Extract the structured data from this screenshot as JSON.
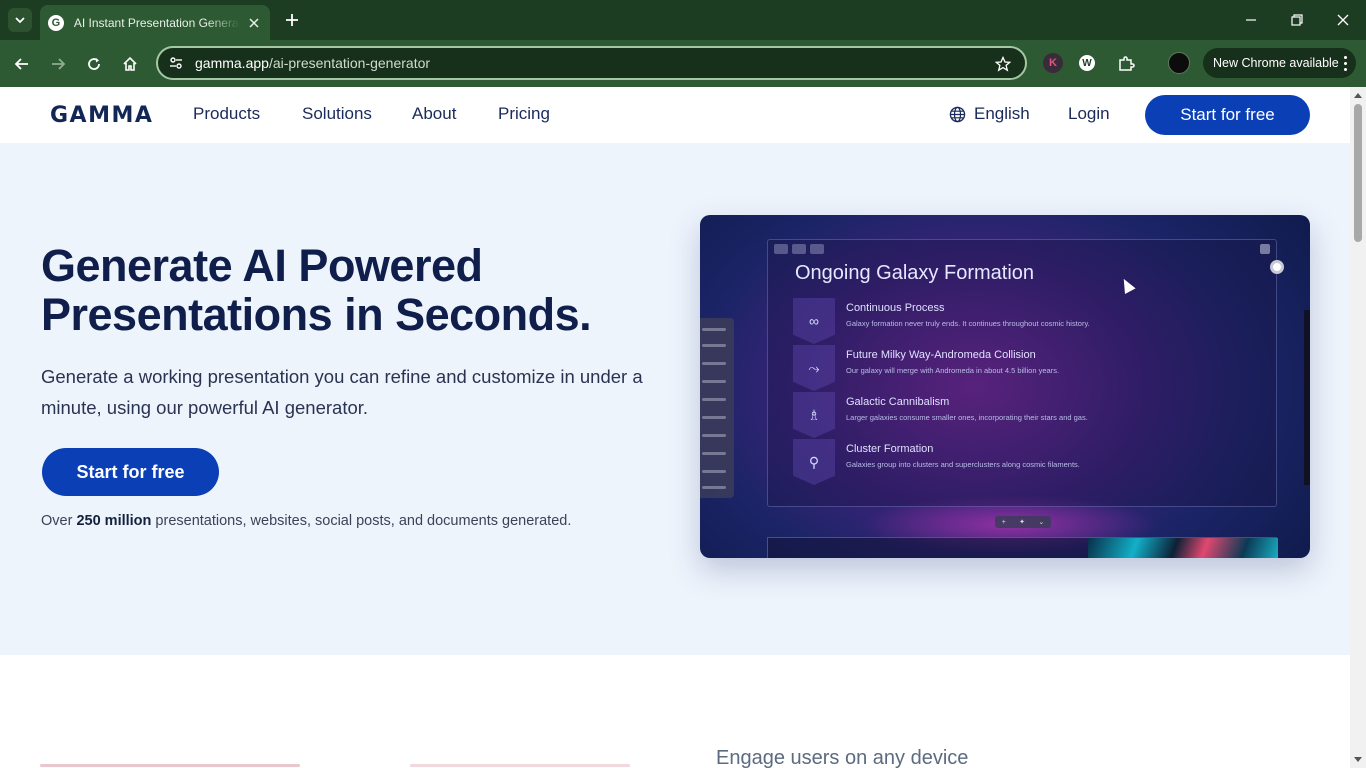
{
  "browser": {
    "tab_title": "AI Instant Presentation Generator",
    "tab_favicon_letter": "G",
    "url_host": "gamma.app",
    "url_path": "/ai-presentation-generator",
    "extension_k_letter": "K",
    "extension_w_letter": "W",
    "update_label": "New Chrome available"
  },
  "header": {
    "logo": "GAMMA",
    "nav": [
      "Products",
      "Solutions",
      "About",
      "Pricing"
    ],
    "language": "English",
    "login": "Login",
    "cta": "Start for free"
  },
  "hero": {
    "title": "Generate AI Powered Presentations in Seconds.",
    "subtitle": "Generate a working presentation you can refine and customize in under a minute, using our powerful AI generator.",
    "cta": "Start for free",
    "stats_prefix": "Over ",
    "stats_bold": "250 million",
    "stats_suffix": " presentations, websites, social posts, and documents generated."
  },
  "preview": {
    "heading": "Ongoing Galaxy Formation",
    "items": [
      {
        "icon": "infinity-icon",
        "glyph": "∞",
        "title": "Continuous Process",
        "desc": "Galaxy formation never truly ends. It continues throughout cosmic history."
      },
      {
        "icon": "merge-icon",
        "glyph": "⤳",
        "title": "Future Milky Way-Andromeda Collision",
        "desc": "Our galaxy will merge with Andromeda in about 4.5 billion years."
      },
      {
        "icon": "chess-piece-icon",
        "glyph": "♗",
        "title": "Galactic Cannibalism",
        "desc": "Larger galaxies consume smaller ones, incorporating their stars and gas."
      },
      {
        "icon": "network-icon",
        "glyph": "⚲",
        "title": "Cluster Formation",
        "desc": "Galaxies group into clusters and superclusters along cosmic filaments."
      }
    ]
  },
  "section2": {
    "title": "Engage users on any device"
  },
  "colors": {
    "brand_blue": "#0a3fb6",
    "navy_text": "#0f1e4a",
    "hero_bg": "#eef4fc",
    "chrome_dark": "#1d3d22",
    "chrome_toolbar": "#2d5a33"
  }
}
